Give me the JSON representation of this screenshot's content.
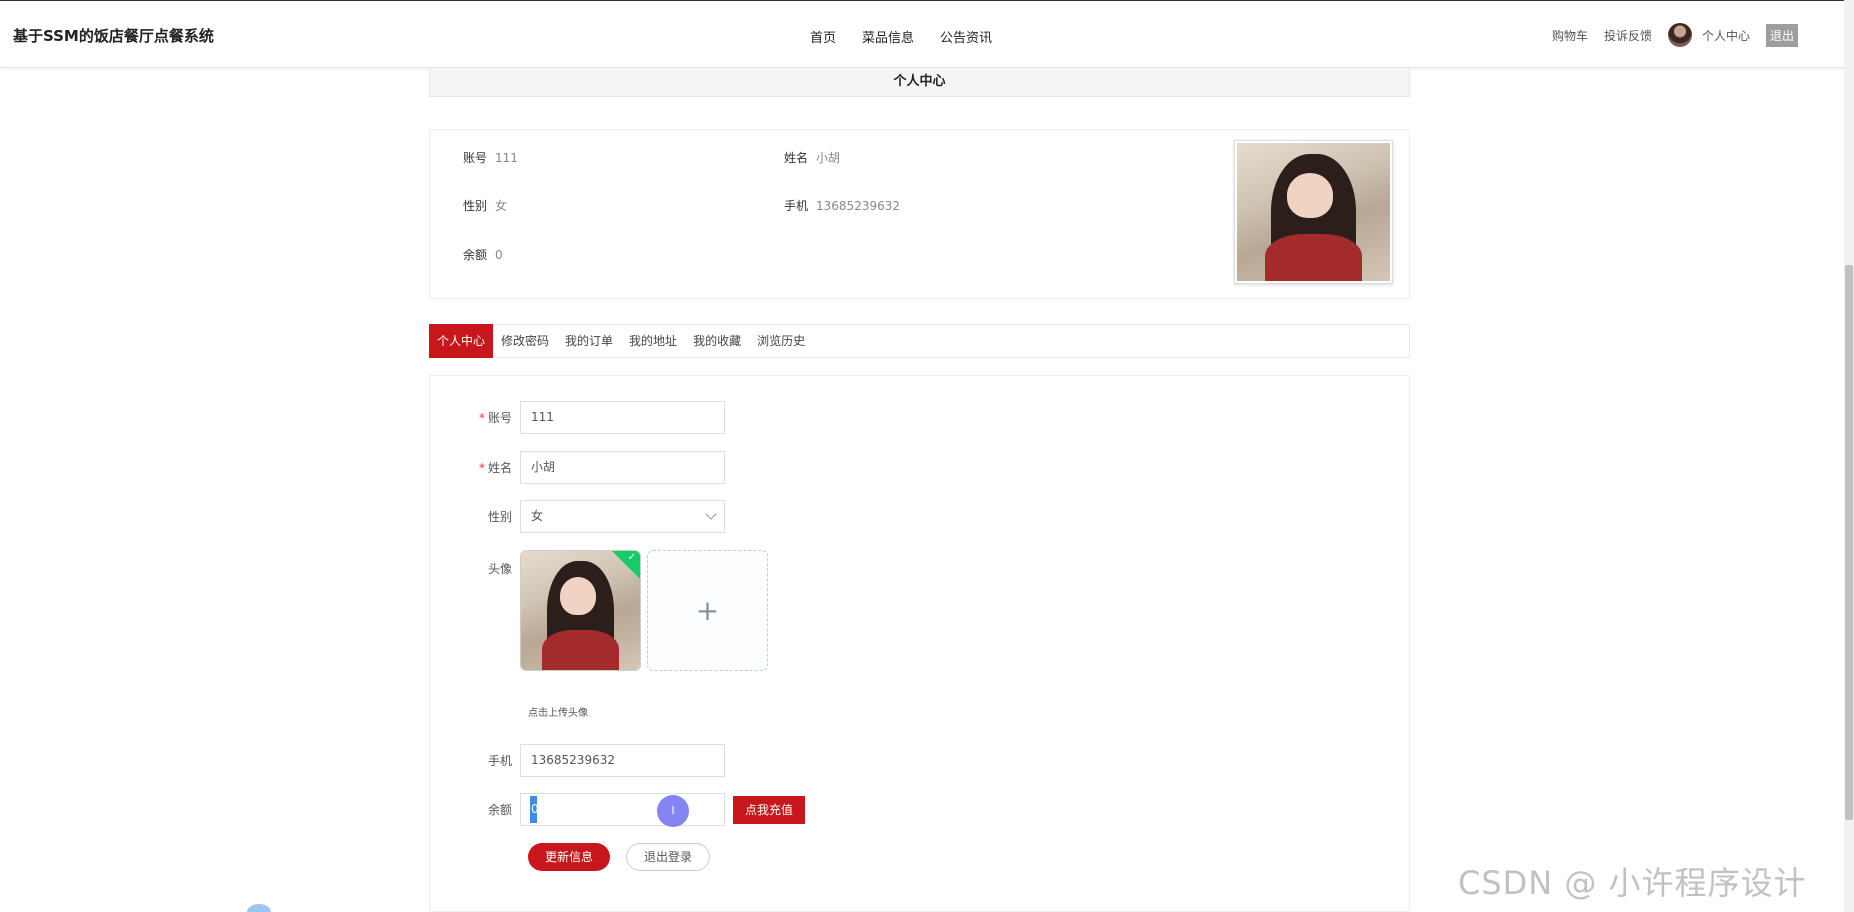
{
  "header": {
    "brand": "基于SSM的饭店餐厅点餐系统",
    "nav": [
      "首页",
      "菜品信息",
      "公告资讯"
    ],
    "right": {
      "cart": "购物车",
      "feedback": "投诉反馈",
      "center": "个人中心",
      "logout": "退出"
    }
  },
  "section_title": "个人中心",
  "info": {
    "account_label": "账号",
    "account": "111",
    "name_label": "姓名",
    "name": "小胡",
    "gender_label": "性别",
    "gender": "女",
    "phone_label": "手机",
    "phone": "13685239632",
    "balance_label": "余额",
    "balance": "0"
  },
  "tabs": [
    "个人中心",
    "修改密码",
    "我的订单",
    "我的地址",
    "我的收藏",
    "浏览历史"
  ],
  "form": {
    "account_label": "账号",
    "account_value": "111",
    "name_label": "姓名",
    "name_value": "小胡",
    "gender_label": "性别",
    "gender_value": "女",
    "avatar_label": "头像",
    "upload_tip": "点击上传头像",
    "upload_plus": "+",
    "phone_label": "手机",
    "phone_value": "13685239632",
    "balance_label": "余额",
    "balance_value": "0",
    "charge_button": "点我充值",
    "update_button": "更新信息",
    "logout_button": "退出登录"
  },
  "watermark": "CSDN @ 小许程序设计",
  "colors": {
    "accent": "#c8161d",
    "success": "#13ce66"
  }
}
